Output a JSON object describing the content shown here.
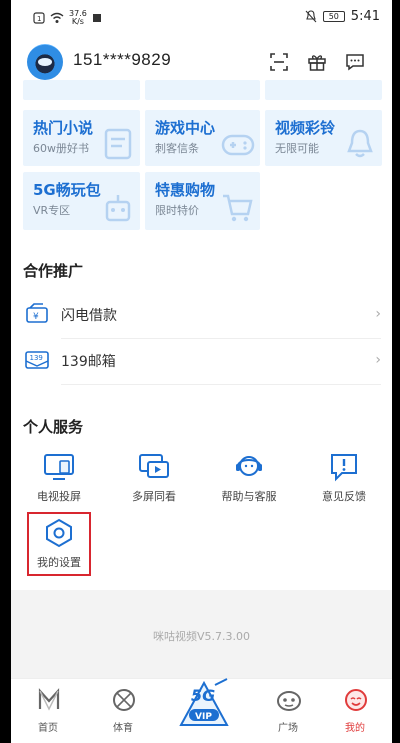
{
  "status_bar": {
    "speed_value": "37.6",
    "speed_unit": "K/s",
    "battery": "50",
    "time": "5:41"
  },
  "header": {
    "phone": "151****9829",
    "icons": [
      "scan-icon",
      "gift-icon",
      "message-icon"
    ]
  },
  "grid": {
    "tiles": [
      {
        "title": "热门小说",
        "subtitle": "60w册好书"
      },
      {
        "title": "游戏中心",
        "subtitle": "刺客信条"
      },
      {
        "title": "视频彩铃",
        "subtitle": "无限可能"
      },
      {
        "title": "5G畅玩包",
        "subtitle": "VR专区"
      },
      {
        "title": "特惠购物",
        "subtitle": "限时特价"
      }
    ]
  },
  "cooperation": {
    "title": "合作推广",
    "items": [
      {
        "label": "闪电借款",
        "icon": "lightning-loan-icon"
      },
      {
        "label": "139邮箱",
        "icon": "mail-139-icon"
      }
    ]
  },
  "personal": {
    "title": "个人服务",
    "items": [
      {
        "label": "电视投屏",
        "icon": "tv-cast-icon"
      },
      {
        "label": "多屏同看",
        "icon": "multi-screen-icon"
      },
      {
        "label": "帮助与客服",
        "icon": "customer-service-icon"
      },
      {
        "label": "意见反馈",
        "icon": "feedback-icon"
      },
      {
        "label": "我的设置",
        "icon": "settings-icon"
      }
    ]
  },
  "version": "咪咕视频V5.7.3.00",
  "tabbar": {
    "tabs": [
      {
        "label": "首页",
        "icon": "home-icon"
      },
      {
        "label": "体育",
        "icon": "sports-icon"
      },
      {
        "label": "",
        "icon": "5g-vip-icon"
      },
      {
        "label": "广场",
        "icon": "square-icon"
      },
      {
        "label": "我的",
        "icon": "profile-icon",
        "active": true
      }
    ]
  },
  "colors": {
    "accent": "#1d6fd1",
    "tile_bg": "#eaf4fd",
    "active_tab": "#e03b3b",
    "highlight_border": "#d8262f"
  }
}
